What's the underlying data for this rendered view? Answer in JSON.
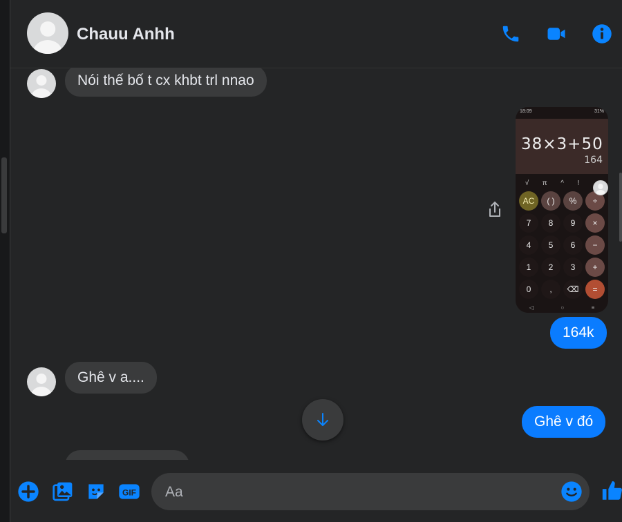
{
  "header": {
    "contact_name": "Chauu Anhh",
    "icons": [
      "phone-icon",
      "video-call-icon",
      "info-icon"
    ]
  },
  "messages": [
    {
      "direction": "incoming",
      "text": "Nói thế bố t cx khbt trl nnao"
    },
    {
      "direction": "outgoing",
      "type": "image",
      "image": {
        "status_time": "18:09",
        "status_battery": "31%",
        "expression": "38×3+50",
        "result": "164",
        "function_row": [
          "√",
          "π",
          "^",
          "!",
          "⌄"
        ],
        "keys": [
          "AC",
          "( )",
          "%",
          "÷",
          "7",
          "8",
          "9",
          "×",
          "4",
          "5",
          "6",
          "−",
          "1",
          "2",
          "3",
          "+",
          "0",
          ",",
          "⌫",
          "="
        ],
        "nav": [
          "◁",
          "○",
          "≡"
        ]
      }
    },
    {
      "direction": "outgoing",
      "text": "164k"
    },
    {
      "direction": "incoming",
      "text": "Ghê v a...."
    },
    {
      "direction": "outgoing",
      "text": "Ghê v đó"
    }
  ],
  "composer": {
    "placeholder": "Aa",
    "icons": [
      "add-icon",
      "photo-icon",
      "sticker-icon",
      "gif-icon",
      "emoji-icon",
      "like-icon"
    ]
  },
  "colors": {
    "background": "#242526",
    "accent": "#0a84ff",
    "incoming_bubble": "#3a3b3c",
    "outgoing_bubble": "#0a7cff"
  }
}
